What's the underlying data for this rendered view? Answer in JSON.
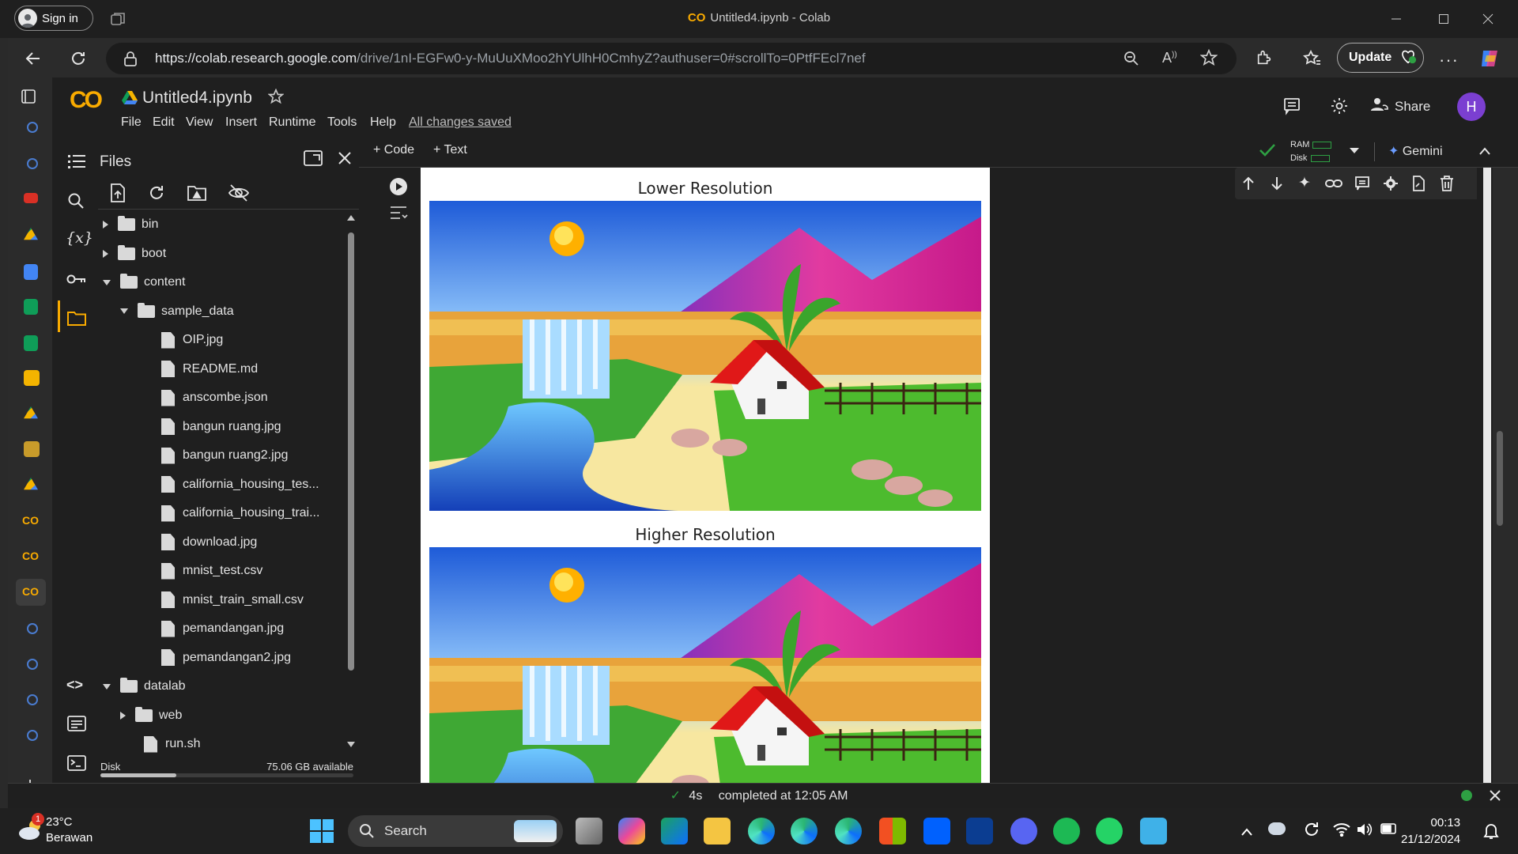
{
  "browser": {
    "sign_in": "Sign in",
    "window_title": "Untitled4.ipynb - Colab",
    "url_domain": "https://colab.research.google.com",
    "url_path": "/drive/1nI-EGFw0-y-MuUuXMoo2hYUlhH0CmhyZ?authuser=0#scrollTo=0PtfFEcl7nef",
    "update_label": "Update"
  },
  "colab": {
    "logo": "CO",
    "notebook_title": "Untitled4.ipynb",
    "menu": [
      "File",
      "Edit",
      "View",
      "Insert",
      "Runtime",
      "Tools",
      "Help"
    ],
    "saved_status": "All changes saved",
    "share_label": "Share",
    "avatar_letter": "H",
    "add_code": "+ Code",
    "add_text": "+ Text",
    "ram_label": "RAM",
    "disk_label": "Disk",
    "gemini_label": "Gemini"
  },
  "files": {
    "header": "Files",
    "tree": [
      {
        "name": "bin",
        "type": "folder",
        "depth": 0,
        "state": "collapsed"
      },
      {
        "name": "boot",
        "type": "folder",
        "depth": 0,
        "state": "collapsed"
      },
      {
        "name": "content",
        "type": "folder",
        "depth": 0,
        "state": "expanded"
      },
      {
        "name": "sample_data",
        "type": "folder",
        "depth": 1,
        "state": "expanded"
      },
      {
        "name": "OIP.jpg",
        "type": "file",
        "depth": 2
      },
      {
        "name": "README.md",
        "type": "file",
        "depth": 2
      },
      {
        "name": "anscombe.json",
        "type": "file",
        "depth": 2
      },
      {
        "name": "bangun ruang.jpg",
        "type": "file",
        "depth": 2
      },
      {
        "name": "bangun ruang2.jpg",
        "type": "file",
        "depth": 2
      },
      {
        "name": "california_housing_tes...",
        "type": "file",
        "depth": 2
      },
      {
        "name": "california_housing_trai...",
        "type": "file",
        "depth": 2
      },
      {
        "name": "download.jpg",
        "type": "file",
        "depth": 2
      },
      {
        "name": "mnist_test.csv",
        "type": "file",
        "depth": 2
      },
      {
        "name": "mnist_train_small.csv",
        "type": "file",
        "depth": 2
      },
      {
        "name": "pemandangan.jpg",
        "type": "file",
        "depth": 2
      },
      {
        "name": "pemandangan2.jpg",
        "type": "file",
        "depth": 2
      },
      {
        "name": "datalab",
        "type": "folder",
        "depth": 0,
        "state": "expanded"
      },
      {
        "name": "web",
        "type": "folder",
        "depth": 1,
        "state": "collapsed"
      },
      {
        "name": "run.sh",
        "type": "file",
        "depth": 1
      }
    ],
    "disk_label": "Disk",
    "disk_available": "75.06 GB available",
    "disk_used_fraction": 0.3
  },
  "output": {
    "title_low": "Lower Resolution",
    "title_high": "Higher Resolution"
  },
  "status": {
    "duration": "4s",
    "message": "completed at 12:05 AM"
  },
  "taskbar": {
    "temperature": "23°C",
    "weather": "Berawan",
    "weather_badge": "1",
    "search": "Search",
    "time": "00:13",
    "date": "21/12/2024"
  },
  "colors": {
    "accent_orange": "#f9ab00",
    "avatar_purple": "#7b3fd1",
    "ok_green": "#2ea043"
  }
}
